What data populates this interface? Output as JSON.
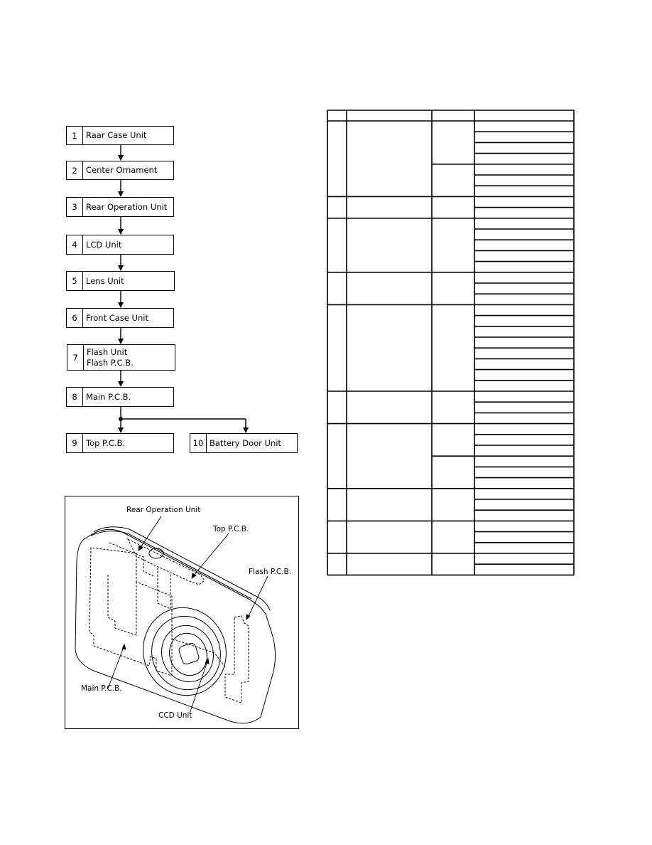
{
  "flowchart": {
    "steps": [
      {
        "num": "1",
        "lines": [
          "Raar Case Unit"
        ]
      },
      {
        "num": "2",
        "lines": [
          "Center Ornament"
        ]
      },
      {
        "num": "3",
        "lines": [
          "Rear Operation Unit"
        ]
      },
      {
        "num": "4",
        "lines": [
          "LCD Unit"
        ]
      },
      {
        "num": "5",
        "lines": [
          "Lens Unit"
        ]
      },
      {
        "num": "6",
        "lines": [
          "Front Case Unit"
        ]
      },
      {
        "num": "7",
        "lines": [
          "Flash Unit",
          "Flash P.C.B."
        ]
      },
      {
        "num": "8",
        "lines": [
          "Main P.C.B."
        ]
      },
      {
        "num": "9",
        "lines": [
          "Top P.C.B."
        ]
      },
      {
        "num": "10",
        "lines": [
          "Battery Door Unit"
        ]
      }
    ]
  },
  "camera_diagram": {
    "callouts": {
      "rear_operation_unit": "Rear Operation Unit",
      "top_pcb": "Top P.C.B.",
      "flash_pcb": "Flash P.C.B.",
      "main_pcb": "Main P.C.B.",
      "ccd_unit": "CCD Unit"
    }
  },
  "table": {
    "columns": 4,
    "header_cells": [
      "",
      "",
      "",
      ""
    ],
    "groups": [
      {
        "sub_groups": [
          4,
          3
        ]
      },
      {
        "sub_groups": [
          2
        ]
      },
      {
        "sub_groups": [
          5
        ]
      },
      {
        "sub_groups": [
          3
        ]
      },
      {
        "sub_groups": [
          8
        ]
      },
      {
        "sub_groups": [
          3
        ]
      },
      {
        "sub_groups": [
          3,
          3
        ]
      },
      {
        "sub_groups": [
          3
        ]
      },
      {
        "sub_groups": [
          3
        ]
      },
      {
        "sub_groups": [
          2
        ]
      }
    ]
  }
}
